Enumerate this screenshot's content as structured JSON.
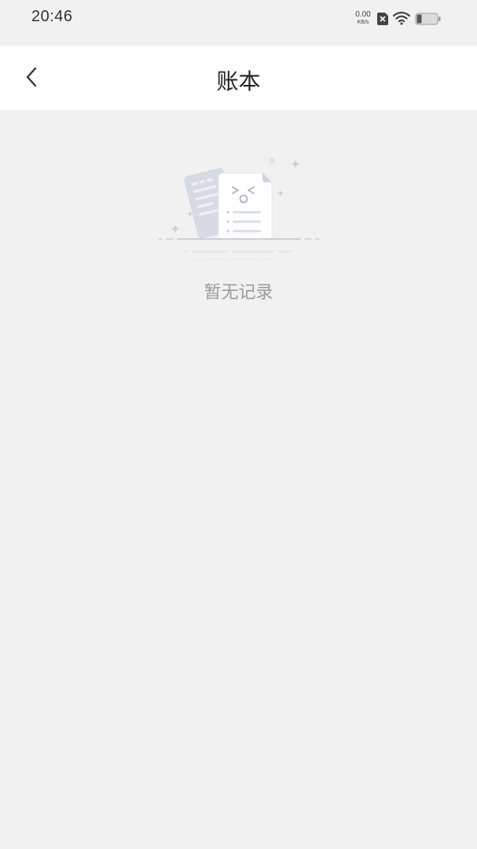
{
  "status_bar": {
    "time": "20:46",
    "net_speed_value": "0.00",
    "net_speed_unit": "KB/s",
    "icons": [
      "sim-card-icon",
      "wifi-icon",
      "battery-icon"
    ]
  },
  "header": {
    "back_icon": "chevron-left-icon",
    "title": "账本"
  },
  "main": {
    "empty_state": {
      "illustration": "empty-document-icon",
      "message": "暂无记录"
    }
  },
  "colors": {
    "background": "#f1f1f1",
    "header_bg": "#ffffff",
    "title": "#222222",
    "empty_text": "#9a9a9a",
    "illustration": "#c9cfdb"
  }
}
